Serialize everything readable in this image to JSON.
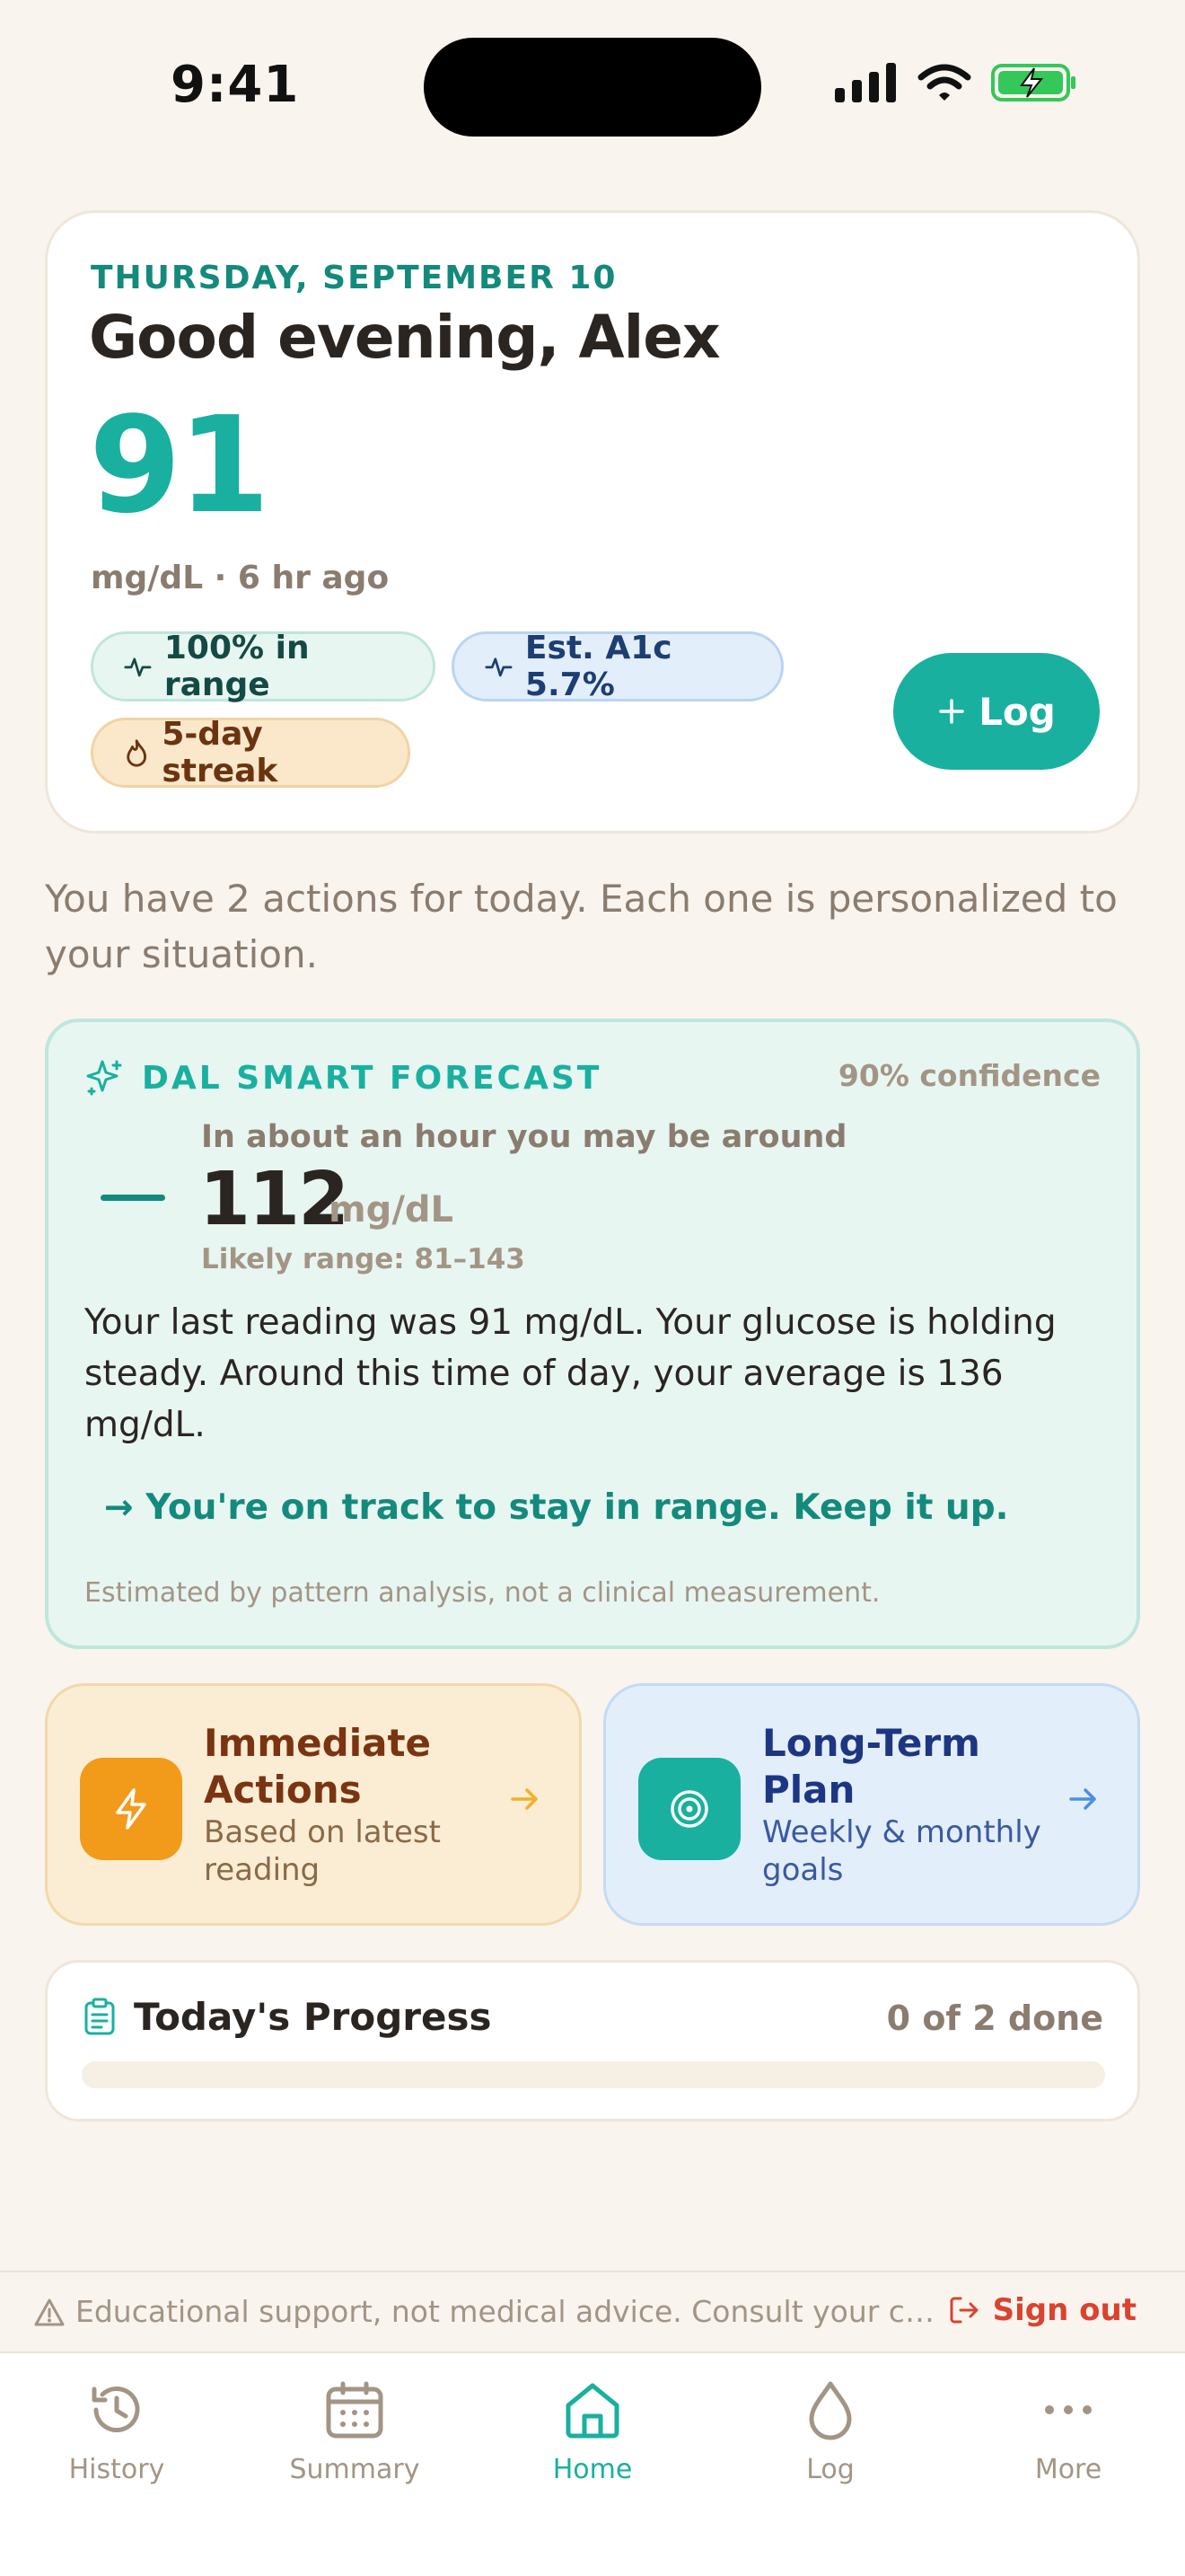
{
  "status_bar": {
    "time": "9:41"
  },
  "hero": {
    "date": "THURSDAY, SEPTEMBER 10",
    "greeting": "Good evening, Alex",
    "glucose_value": "91",
    "glucose_meta": "mg/dL · 6 hr ago",
    "pills": {
      "in_range": "100% in range",
      "a1c": "Est. A1c 5.7%",
      "streak": "5-day streak"
    },
    "log_button": "Log"
  },
  "intro": "You have 2 actions for today. Each one is personalized to your situation.",
  "forecast": {
    "title": "DAL SMART FORECAST",
    "confidence": "90% confidence",
    "lead": "In about an hour you may be around",
    "value": "112",
    "unit": "mg/dL",
    "range": "Likely range: 81–143",
    "body": "Your last reading was 91 mg/dL. Your glucose is holding steady. Around this time of day, your average is 136 mg/dL.",
    "cta": "→ You're on track to stay in range. Keep it up.",
    "note": "Estimated by pattern analysis, not a clinical measurement."
  },
  "plans": {
    "immediate": {
      "title": "Immediate Actions",
      "subtitle": "Based on latest reading",
      "icon": "lightning-icon"
    },
    "long_term": {
      "title": "Long-Term Plan",
      "subtitle": "Weekly & monthly goals",
      "icon": "target-icon"
    }
  },
  "progress": {
    "title": "Today's Progress",
    "count": "0 of 2 done",
    "done": 0,
    "total": 2
  },
  "disclaimer": {
    "text": "Educational support, not medical advice. Consult your care team.",
    "sign_out": "Sign out"
  },
  "tabs": [
    {
      "label": "History",
      "icon": "history-icon"
    },
    {
      "label": "Summary",
      "icon": "calendar-icon"
    },
    {
      "label": "Home",
      "icon": "home-icon",
      "active": true
    },
    {
      "label": "Log",
      "icon": "drop-icon"
    },
    {
      "label": "More",
      "icon": "more-icon"
    }
  ],
  "colors": {
    "accent": "#19b0a0",
    "accent_dark": "#138a7c",
    "background": "#f9f4ee",
    "danger": "#d9432f",
    "warning": "#f29b1b"
  }
}
